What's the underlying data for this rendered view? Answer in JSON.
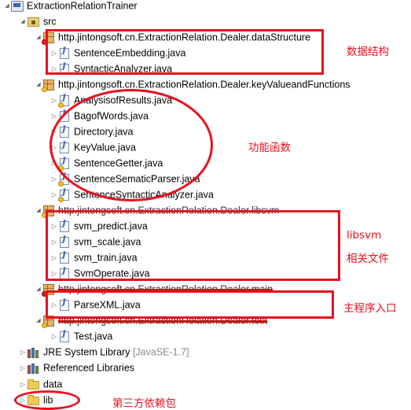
{
  "tree": {
    "project": "ExtractionRelationTrainer",
    "src": "src",
    "packages": {
      "data_structure": "http.jintongsoft.cn.ExtractionRelation.Dealer.dataStructure",
      "key_value_functions": "http.jintongsoft.cn.ExtractionRelation.Dealer.keyValueandFunctions",
      "libsvm": "http.jintongsoft.cn.ExtractionRelation.Dealer.libsvm",
      "main": "http.jintongsoft.cn.ExtractionRelation.Dealer.main",
      "test": "http.jintongsoft.cn.ExtractionRelation.Dealer.test"
    },
    "files": {
      "sentence_embedding": "SentenceEmbedding.java",
      "syntactic_analyzer": "SyntacticAnalyzer.java",
      "analysis_of_results": "AnalysisofResults.java",
      "bag_of_words": "BagofWords.java",
      "directory": "Directory.java",
      "key_value": "KeyValue.java",
      "sentence_getter": "SentenceGetter.java",
      "sentence_sematic_parser": "SentenceSematicParser.java",
      "sentence_syntactic_analyzer": "SentenceSyntacticAnalyzer.java",
      "svm_predict": "svm_predict.java",
      "svm_scale": "svm_scale.java",
      "svm_train": "svm_train.java",
      "svm_operate": "SvmOperate.java",
      "parse_xml": "ParseXML.java",
      "test": "Test.java"
    },
    "jre_library": "JRE System Library",
    "jre_version": "[JavaSE-1.7]",
    "referenced_libraries": "Referenced Libraries",
    "data_folder": "data",
    "lib_folder": "lib"
  },
  "annotations": {
    "data_structure": "数据结构",
    "functions": "功能函数",
    "libsvm_title": "libsvm",
    "libsvm_subtitle": "相关文件",
    "main_entry": "主程序入口",
    "third_party": "第三方依赖包"
  },
  "colors": {
    "highlight": "#e8101e",
    "decoration": "#8a8a8a"
  }
}
